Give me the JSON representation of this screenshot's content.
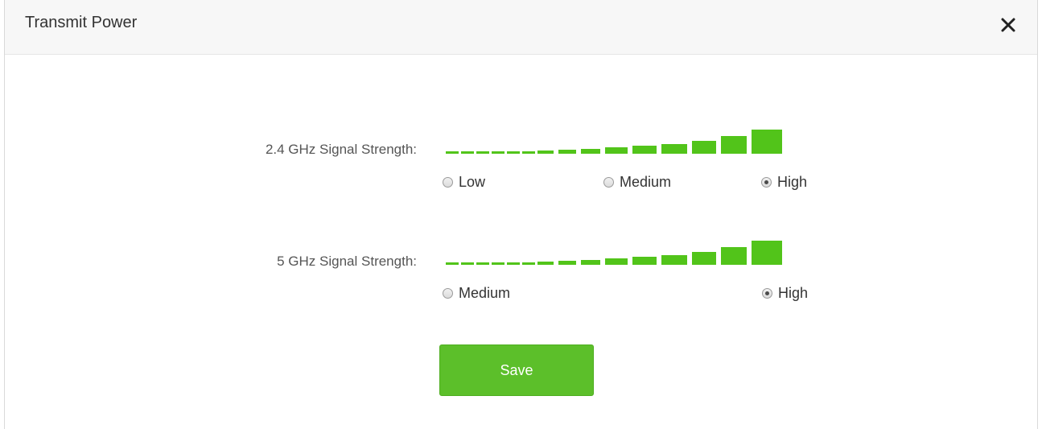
{
  "dialog": {
    "title": "Transmit Power",
    "close_icon": "close-icon"
  },
  "band_24": {
    "label": "2.4 GHz Signal Strength:",
    "options": [
      {
        "label": "Low",
        "checked": false
      },
      {
        "label": "Medium",
        "checked": false
      },
      {
        "label": "High",
        "checked": true
      }
    ]
  },
  "band_5": {
    "label": "5 GHz Signal Strength:",
    "options": [
      {
        "label": "Medium",
        "checked": false
      },
      {
        "label": "High",
        "checked": true
      }
    ]
  },
  "save_label": "Save",
  "colors": {
    "accent_green": "#5cbf2a",
    "bar_green": "#52c41a"
  }
}
